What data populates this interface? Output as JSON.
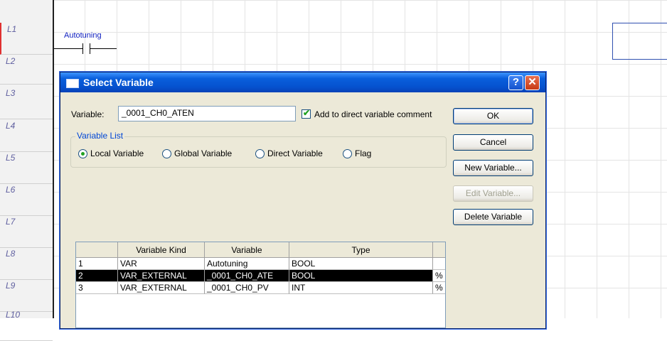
{
  "ladder": {
    "rows": [
      "L1",
      "L2",
      "L3",
      "L4",
      "L5",
      "L6",
      "L7",
      "L8",
      "L9",
      "L10"
    ],
    "contact_label": "Autotuning"
  },
  "dialog": {
    "title": "Select Variable",
    "variable_label": "Variable:",
    "variable_value": "_0001_CH0_ATEN",
    "add_comment_label": "Add to direct variable comment",
    "add_comment_checked": true,
    "variable_list": {
      "label": "Variable List",
      "options": [
        "Local Variable",
        "Global Variable",
        "Direct Variable",
        "Flag"
      ],
      "selected": "Local Variable"
    },
    "buttons": {
      "ok": "OK",
      "cancel": "Cancel",
      "new_variable": "New Variable...",
      "edit_variable": "Edit Variable...",
      "delete_variable": "Delete Variable"
    },
    "table": {
      "headers": [
        "",
        "Variable Kind",
        "Variable",
        "Type",
        ""
      ],
      "rows": [
        [
          "1",
          "VAR",
          "Autotuning",
          "BOOL",
          ""
        ],
        [
          "2",
          "VAR_EXTERNAL",
          "_0001_CH0_ATE",
          "BOOL",
          "%"
        ],
        [
          "3",
          "VAR_EXTERNAL",
          "_0001_CH0_PV",
          "INT",
          "%"
        ]
      ],
      "selected_row": 2
    }
  }
}
